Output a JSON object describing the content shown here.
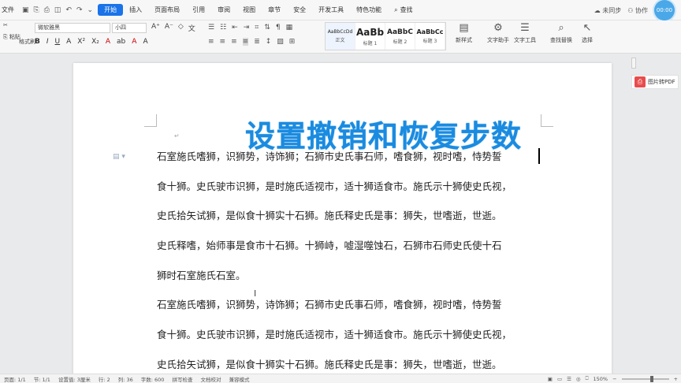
{
  "menu": {
    "file": "文件",
    "tabs": [
      "开始",
      "插入",
      "页面布局",
      "引用",
      "审阅",
      "视图",
      "章节",
      "安全",
      "开发工具",
      "特色功能"
    ],
    "active_tab": "开始",
    "search": "查找",
    "right": {
      "sync": "未同步",
      "collab": "协作",
      "timer": "00:00"
    }
  },
  "ribbon": {
    "paste_label": "粘贴",
    "format_painter": "格式刷",
    "font_name": "微软雅黑",
    "font_size": "小四",
    "styles": [
      {
        "preview": "AaBbCcDd",
        "name": "正文"
      },
      {
        "preview": "AaBb",
        "name": "标题 1"
      },
      {
        "preview": "AaBbC",
        "name": "标题 2"
      },
      {
        "preview": "AaBbCc",
        "name": "标题 3"
      }
    ],
    "new_style": "新样式",
    "text_assistant": "文字助手",
    "text_tools": "文字工具",
    "find_replace": "查找替换",
    "select": "选择"
  },
  "side_button": {
    "label": "图片转PDF"
  },
  "document": {
    "title": "设置撤销和恢复步数",
    "lines": [
      "石室施氏嗜狮，识狮势，诗饰狮；石狮市史氏事石师，嗜食狮，视时嗜，恃势誓",
      "食十狮。史氏驶市识狮，是时施氏适视市，适十狮适食市。施氏示十狮使史氏视，",
      "史氏拾矢试狮，是似食十狮实十石狮。施氏释史氏是事：狮失，世嗜逝，世逝。",
      "史氏释嗜，始师事是食市十石狮。十狮峙，嘘湿噬蚀石，石狮市石师史氏使十石",
      "狮时石室施氏石室。",
      "石室施氏嗜狮，识狮势，诗饰狮；石狮市史氏事石师，嗜食狮，视时嗜，恃势誓",
      "食十狮。史氏驶市识狮，是时施氏适视市，适十狮适食市。施氏示十狮使史氏视，",
      "史氏拾矢试狮，是似食十狮实十石狮。施氏释史氏是事：狮失，世嗜逝，世逝。"
    ]
  },
  "status": {
    "page": "页面: 1/1",
    "section": "节: 1/1",
    "setting": "设置值: 3厘米",
    "row": "行: 2",
    "col": "列: 36",
    "words": "字数: 600",
    "spell": "拼写检查",
    "proofread": "文档校对",
    "mode": "兼容模式",
    "zoom": "150%"
  }
}
